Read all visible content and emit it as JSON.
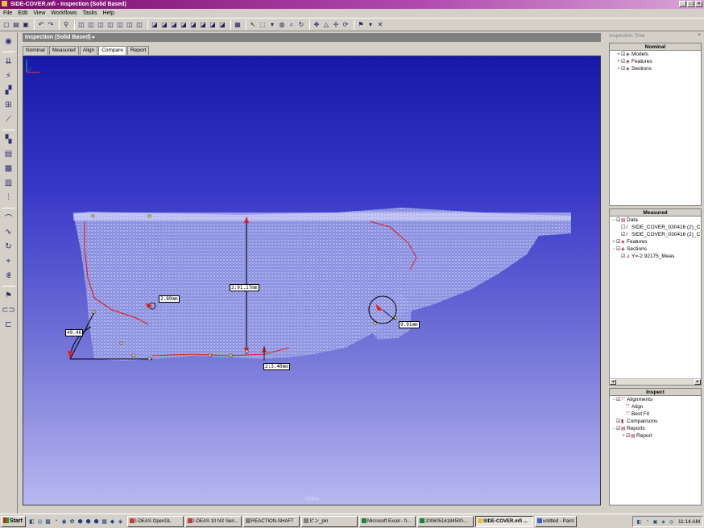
{
  "window": {
    "title": "SIDE-COVER.mfi - Inspection (Solid Based)",
    "buttons": [
      "_",
      "□",
      "×"
    ]
  },
  "menu": [
    "File",
    "Edit",
    "View",
    "Workflows",
    "Tasks",
    "Help"
  ],
  "workspace": {
    "header": "Inspection (Solid Based)",
    "tabs": [
      {
        "label": "Nominal",
        "active": false
      },
      {
        "label": "Measured",
        "active": false
      },
      {
        "label": "Align",
        "active": false
      },
      {
        "label": "Compare",
        "active": true
      },
      {
        "label": "Report",
        "active": false
      }
    ],
    "view_mode": "Ortho"
  },
  "dimensions": {
    "radius_left": "2.89mm",
    "height": "2:91.17mm",
    "radius_right": "9.91mm",
    "angle": "49.46",
    "bottom": "2:3.40mm"
  },
  "inspection_tree": {
    "title": "Inspection Tree",
    "close": "×",
    "nominal": {
      "header": "Nominal",
      "items": [
        {
          "label": "Models",
          "indent": 1,
          "expander": "+"
        },
        {
          "label": "Features",
          "indent": 1,
          "expander": "+"
        },
        {
          "label": "Sections",
          "indent": 1,
          "expander": "+"
        }
      ]
    },
    "measured": {
      "header": "Measured",
      "items": [
        {
          "label": "Data",
          "indent": 0,
          "expander": "−"
        },
        {
          "label": "SIDE_COVER_030416 (2)_C",
          "indent": 1,
          "expander": ""
        },
        {
          "label": "SIDE_COVER_030416 (2)_C",
          "indent": 1,
          "expander": ""
        },
        {
          "label": "Features",
          "indent": 0,
          "expander": "+"
        },
        {
          "label": "Sections",
          "indent": 0,
          "expander": "−"
        },
        {
          "label": "Y=-2.92175_Meas",
          "indent": 1,
          "expander": ""
        }
      ]
    },
    "inspect": {
      "header": "Inspect",
      "items": [
        {
          "label": "Alignments",
          "indent": 0,
          "expander": "−"
        },
        {
          "label": "Align",
          "indent": 1,
          "expander": ""
        },
        {
          "label": "Best Fit",
          "indent": 1,
          "expander": ""
        },
        {
          "label": "Comparisons",
          "indent": 0,
          "expander": ""
        },
        {
          "label": "Reports",
          "indent": 0,
          "expander": "−"
        },
        {
          "label": "Report",
          "indent": 1,
          "expander": "+"
        }
      ]
    }
  },
  "taskbar": {
    "start": "Start",
    "tasks": [
      {
        "label": "I-DEAS OpenGL",
        "active": false,
        "w": 67
      },
      {
        "label": "I-DEAS 10 NX Seri...",
        "active": false,
        "w": 67
      },
      {
        "label": "REACTION-SHAFT",
        "active": false,
        "w": 67
      },
      {
        "label": "ピン_pin",
        "active": false,
        "w": 67
      },
      {
        "label": "Microsoft Excel - fi...",
        "active": false,
        "w": 67
      },
      {
        "label": "20060516184500-...",
        "active": false,
        "w": 67
      },
      {
        "label": "SIDE-COVER.mfi ...",
        "active": true,
        "w": 67
      },
      {
        "label": "untitled - Paint",
        "active": false,
        "w": 50
      }
    ],
    "clock": "11:14 AM"
  }
}
